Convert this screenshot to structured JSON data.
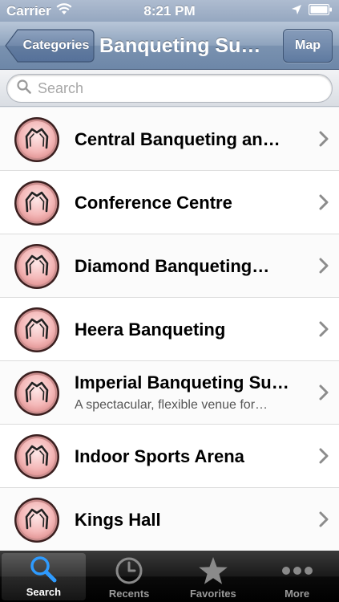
{
  "status_bar": {
    "carrier": "Carrier",
    "time": "8:21 PM"
  },
  "nav": {
    "back_label": "Categories",
    "title": "Banqueting Su…",
    "map_label": "Map"
  },
  "search": {
    "placeholder": "Search",
    "value": ""
  },
  "list": {
    "items": [
      {
        "title": "Central Banqueting an…",
        "subtitle": ""
      },
      {
        "title": "Conference Centre",
        "subtitle": ""
      },
      {
        "title": "Diamond Banqueting…",
        "subtitle": ""
      },
      {
        "title": "Heera Banqueting",
        "subtitle": ""
      },
      {
        "title": "Imperial Banqueting Su…",
        "subtitle": "A spectacular, flexible venue for…"
      },
      {
        "title": "Indoor Sports Arena",
        "subtitle": ""
      },
      {
        "title": "Kings Hall",
        "subtitle": ""
      }
    ]
  },
  "tabs": [
    {
      "label": "Search",
      "icon": "search-icon",
      "active": true
    },
    {
      "label": "Recents",
      "icon": "clock-icon",
      "active": false
    },
    {
      "label": "Favorites",
      "icon": "star-icon",
      "active": false
    },
    {
      "label": "More",
      "icon": "more-icon",
      "active": false
    }
  ],
  "colors": {
    "nav_blue": "#7a92b0",
    "active_tab_icon": "#2e9bff"
  }
}
